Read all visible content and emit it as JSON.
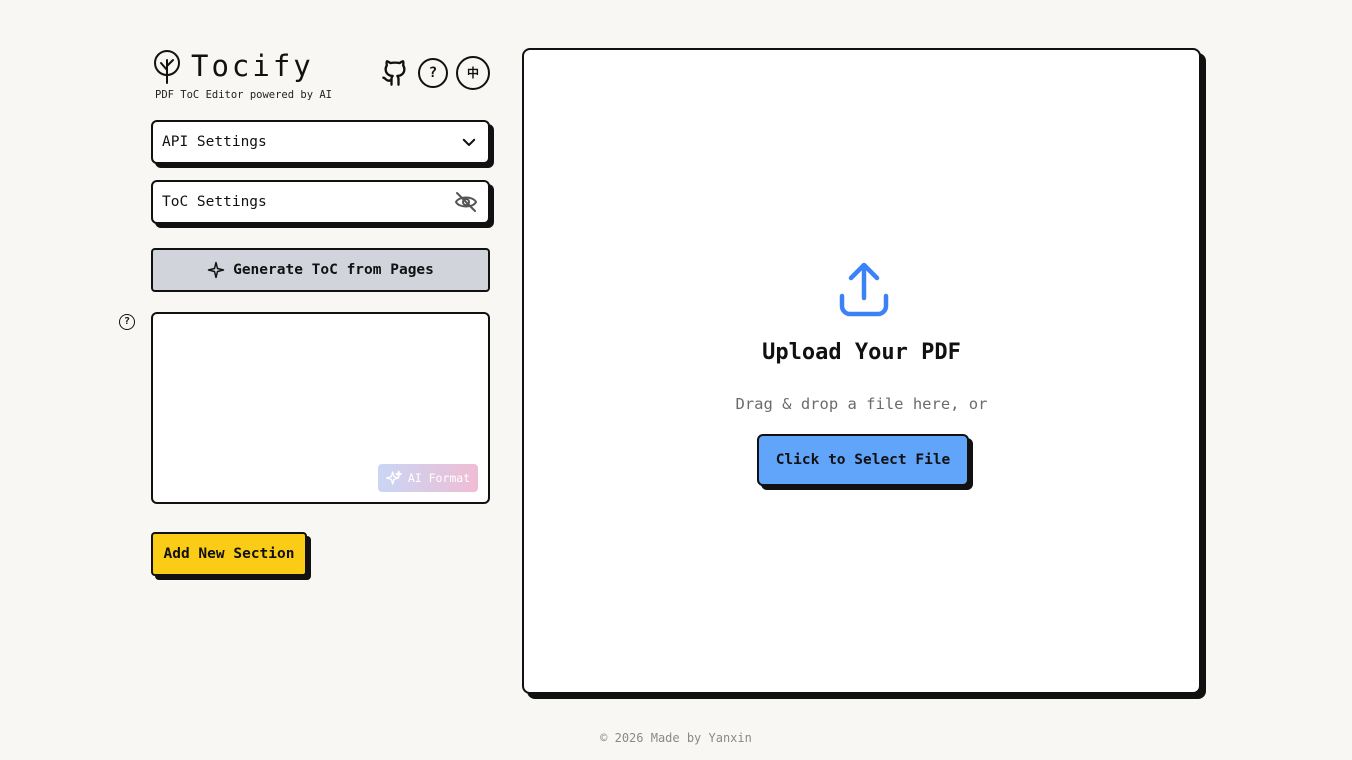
{
  "brand": {
    "title": "Tocify",
    "subtitle": "PDF ToC Editor powered by AI",
    "logo_icon": "tree-icon"
  },
  "header_icons": {
    "github": "github-icon",
    "help": "?",
    "language": "中"
  },
  "api_settings": {
    "label": "API Settings",
    "icon": "chevron-down-icon"
  },
  "toc_settings": {
    "label": "ToC Settings",
    "icon": "eye-off-icon"
  },
  "generate": {
    "label": "Generate ToC from Pages",
    "icon": "sparkle-icon"
  },
  "editor": {
    "help": "?",
    "value": "",
    "ai_format_label": "AI Format"
  },
  "add_section": {
    "label": "Add New Section"
  },
  "upload": {
    "title": "Upload Your PDF",
    "subtitle": "Drag & drop a file here, or",
    "button_label": "Click to Select File",
    "icon": "upload-icon"
  },
  "footer": {
    "text": "© 2026 Made by Yanxin"
  },
  "colors": {
    "background": "#f8f7f3",
    "add_section": "#facc15",
    "select_file": "#60a5fa",
    "generate_disabled": "#d1d5db"
  }
}
